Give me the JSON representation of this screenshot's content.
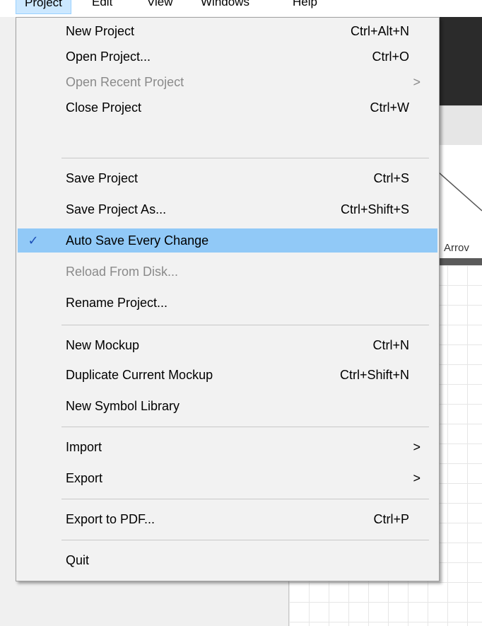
{
  "menubar": {
    "items": [
      "Project",
      "Edit",
      "View",
      "Windows",
      "Help"
    ]
  },
  "background": {
    "arrow_label": "Arrov"
  },
  "menu": {
    "items": [
      {
        "label": "New Project",
        "shortcut": "Ctrl+Alt+N",
        "enabled": true
      },
      {
        "label": "Open Project...",
        "shortcut": "Ctrl+O",
        "enabled": true
      },
      {
        "label": "Open Recent Project",
        "shortcut": "",
        "submenu": ">",
        "enabled": false
      },
      {
        "label": "Close Project",
        "shortcut": "Ctrl+W",
        "enabled": true
      },
      {
        "label": "Save Project",
        "shortcut": "Ctrl+S",
        "enabled": true
      },
      {
        "label": "Save Project As...",
        "shortcut": "Ctrl+Shift+S",
        "enabled": true
      },
      {
        "label": "Auto Save Every Change",
        "shortcut": "",
        "checked": true,
        "check_glyph": "✓",
        "highlighted": true,
        "enabled": true
      },
      {
        "label": "Reload From Disk...",
        "shortcut": "",
        "enabled": false
      },
      {
        "label": "Rename Project...",
        "shortcut": "",
        "enabled": true
      },
      {
        "label": "New Mockup",
        "shortcut": "Ctrl+N",
        "enabled": true
      },
      {
        "label": "Duplicate Current Mockup",
        "shortcut": "Ctrl+Shift+N",
        "enabled": true
      },
      {
        "label": "New Symbol Library",
        "shortcut": "",
        "enabled": true
      },
      {
        "label": "Import",
        "shortcut": "",
        "submenu": ">",
        "enabled": true
      },
      {
        "label": "Export",
        "shortcut": "",
        "submenu": ">",
        "enabled": true
      },
      {
        "label": "Export to PDF...",
        "shortcut": "Ctrl+P",
        "enabled": true
      },
      {
        "label": "Quit",
        "shortcut": "",
        "enabled": true
      }
    ]
  },
  "colors": {
    "highlight": "#91c9f7",
    "disabled_text": "#8a8a8a",
    "check": "#1c4fb8"
  }
}
